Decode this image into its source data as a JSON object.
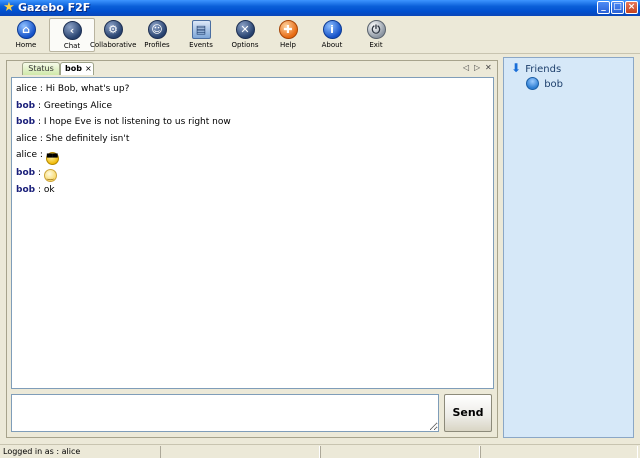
{
  "window": {
    "title": "Gazebo F2F"
  },
  "toolbar": {
    "buttons": [
      {
        "id": "home",
        "label": "Home",
        "glyph": "⌂",
        "icon": "home-icon"
      },
      {
        "id": "chat",
        "label": "Chat",
        "glyph": "‹",
        "icon": "chat-icon"
      },
      {
        "id": "collaborative",
        "label": "Collaborative",
        "glyph": "⚙",
        "icon": "gear-icon"
      },
      {
        "id": "profiles",
        "label": "Profiles",
        "glyph": "☺",
        "icon": "person-icon"
      },
      {
        "id": "events",
        "label": "Events",
        "glyph": "▤",
        "icon": "monitor-icon"
      },
      {
        "id": "options",
        "label": "Options",
        "glyph": "✕",
        "icon": "tools-icon"
      },
      {
        "id": "help",
        "label": "Help",
        "glyph": "✚",
        "icon": "lifebuoy-icon"
      },
      {
        "id": "about",
        "label": "About",
        "glyph": "i",
        "icon": "info-icon"
      },
      {
        "id": "exit",
        "label": "Exit",
        "glyph": "⏻",
        "icon": "power-icon"
      }
    ],
    "active": "chat"
  },
  "tabs": {
    "items": [
      {
        "label": "Status"
      },
      {
        "label": "bob"
      }
    ],
    "active": "bob"
  },
  "messages": [
    {
      "sender": "alice",
      "text": "Hi Bob, what's up?"
    },
    {
      "sender": "bob",
      "text": "Greetings Alice"
    },
    {
      "sender": "bob",
      "text": "I hope Eve is not listening to us right now"
    },
    {
      "sender": "alice",
      "text": "She definitely isn't"
    },
    {
      "sender": "alice",
      "text": "",
      "emoji": "cool-face"
    },
    {
      "sender": "bob",
      "text": "",
      "emoji": "smile-face"
    },
    {
      "sender": "bob",
      "text": "ok"
    }
  ],
  "composer": {
    "value": "",
    "send_label": "Send"
  },
  "friends": {
    "group_label": "Friends",
    "items": [
      {
        "name": "bob"
      }
    ]
  },
  "status": {
    "logged_in": "Logged in as : alice"
  },
  "colors": {
    "title_bar": "#0a5fd8",
    "friends_bg": "#d6e8f8",
    "bob_name": "#1a1f7a"
  }
}
